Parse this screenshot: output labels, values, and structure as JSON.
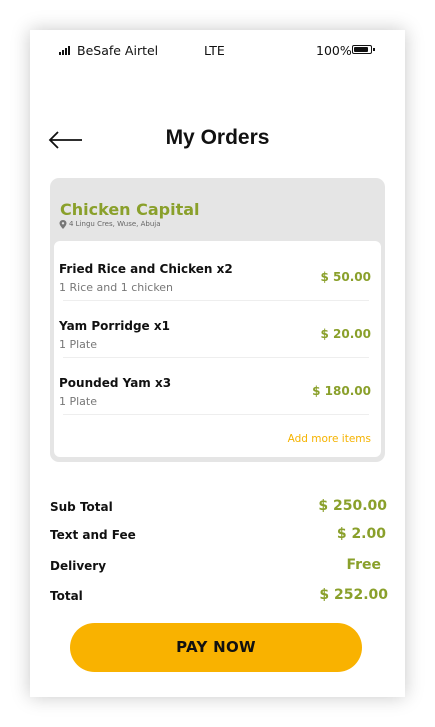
{
  "status_bar": {
    "carrier": "BeSafe Airtel",
    "network": "LTE",
    "battery": "100%"
  },
  "header": {
    "back_icon": "arrow-left-icon",
    "title": "My Orders"
  },
  "restaurant": {
    "name": "Chicken Capital",
    "address": "4 Lingu Cres, Wuse, Abuja",
    "address_icon": "map-pin-icon",
    "items": [
      {
        "name": "Fried Rice and Chicken x2",
        "description": "1 Rice and 1 chicken",
        "price": "$ 50.00"
      },
      {
        "name": "Yam Porridge x1",
        "description": "1 Plate",
        "price": "$ 20.00"
      },
      {
        "name": "Pounded Yam x3",
        "description": "1 Plate",
        "price": "$ 180.00"
      }
    ],
    "add_more_label": "Add more items"
  },
  "summary": {
    "rows": [
      {
        "label": "Sub Total",
        "value": "$ 250.00"
      },
      {
        "label": "Text and Fee",
        "value": "$ 2.00"
      },
      {
        "label": "Delivery",
        "value": "Free"
      },
      {
        "label": "Total",
        "value": "$ 252.00"
      }
    ]
  },
  "pay_button": {
    "label": "PAY NOW"
  },
  "colors": {
    "accent_green": "#8aa02b",
    "accent_yellow": "#f9b200",
    "card_bg": "#e5e5e5"
  }
}
